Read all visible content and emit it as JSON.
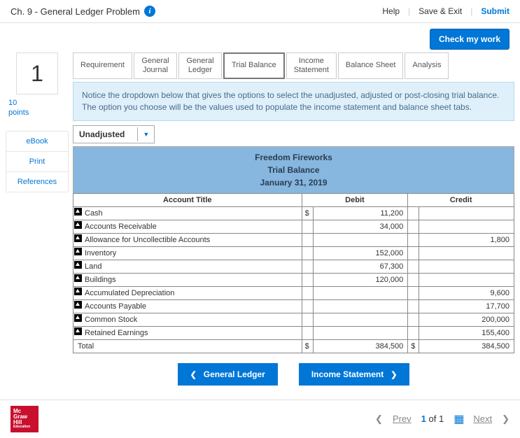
{
  "header": {
    "title": "Ch. 9 - General Ledger Problem",
    "links": {
      "help": "Help",
      "save_exit": "Save & Exit",
      "submit": "Submit"
    }
  },
  "toolbar": {
    "check": "Check my work"
  },
  "question": {
    "number": "1",
    "points_value": "10",
    "points_label": "points"
  },
  "sidebar": {
    "ebook": "eBook",
    "print": "Print",
    "references": "References"
  },
  "tabs": [
    {
      "label": "Requirement"
    },
    {
      "label": "General\nJournal"
    },
    {
      "label": "General\nLedger"
    },
    {
      "label": "Trial Balance"
    },
    {
      "label": "Income\nStatement"
    },
    {
      "label": "Balance Sheet"
    },
    {
      "label": "Analysis"
    }
  ],
  "active_tab_index": 3,
  "notice": "Notice the dropdown below that gives the options to select the unadjusted, adjusted or post-closing trial balance. The option you choose will be the values used to populate the income statement and balance sheet tabs.",
  "dropdown": {
    "value": "Unadjusted"
  },
  "report": {
    "company": "Freedom Fireworks",
    "title": "Trial Balance",
    "date": "January 31, 2019",
    "columns": {
      "title": "Account Title",
      "debit": "Debit",
      "credit": "Credit"
    },
    "rows": [
      {
        "name": "Cash",
        "debit": "11,200",
        "credit": "",
        "cur_d": "$"
      },
      {
        "name": "Accounts Receivable",
        "debit": "34,000",
        "credit": ""
      },
      {
        "name": "Allowance for Uncollectible Accounts",
        "debit": "",
        "credit": "1,800"
      },
      {
        "name": "Inventory",
        "debit": "152,000",
        "credit": ""
      },
      {
        "name": "Land",
        "debit": "67,300",
        "credit": ""
      },
      {
        "name": "Buildings",
        "debit": "120,000",
        "credit": ""
      },
      {
        "name": "Accumulated Depreciation",
        "debit": "",
        "credit": "9,600"
      },
      {
        "name": "Accounts Payable",
        "debit": "",
        "credit": "17,700"
      },
      {
        "name": "Common Stock",
        "debit": "",
        "credit": "200,000"
      },
      {
        "name": "Retained Earnings",
        "debit": "",
        "credit": "155,400"
      }
    ],
    "total": {
      "label": "Total",
      "debit": "384,500",
      "credit": "384,500",
      "cur_d": "$",
      "cur_c": "$"
    }
  },
  "nav": {
    "prev": "General Ledger",
    "next": "Income Statement"
  },
  "footer": {
    "logo": {
      "l1": "Mc",
      "l2": "Graw",
      "l3": "Hill",
      "l4": "Education"
    },
    "pager": {
      "prev": "Prev",
      "current": "1",
      "of": "of",
      "total": "1",
      "next": "Next"
    }
  }
}
